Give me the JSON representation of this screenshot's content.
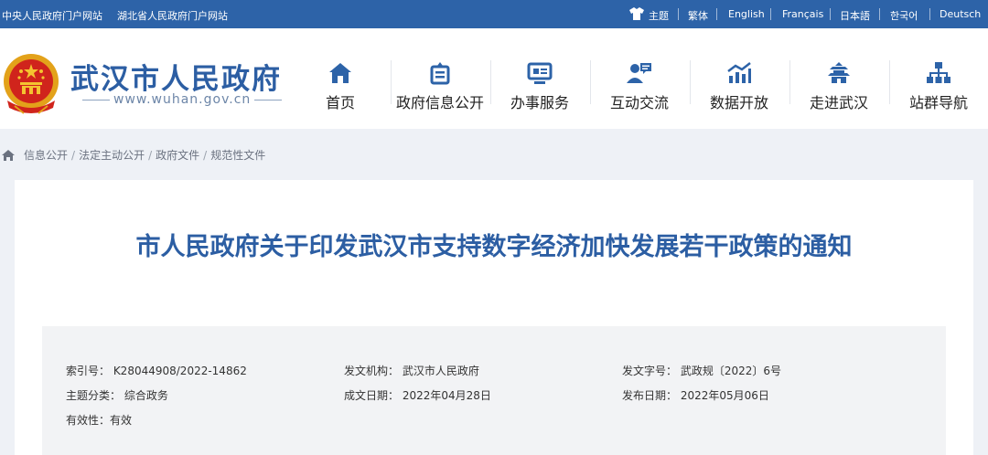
{
  "topbar": {
    "link_central": "中央人民政府门户网站",
    "link_province": "湖北省人民政府门户网站",
    "theme": "主题",
    "languages": [
      "繁体",
      "English",
      "Français",
      "日本語",
      "한국어",
      "Deutsch"
    ]
  },
  "header": {
    "site_title": "武汉市人民政府",
    "site_url": "www.wuhan.gov.cn"
  },
  "nav": [
    {
      "label": "首页",
      "icon": "home-icon"
    },
    {
      "label": "政府信息公开",
      "icon": "info-disclosure-icon"
    },
    {
      "label": "办事服务",
      "icon": "service-icon"
    },
    {
      "label": "互动交流",
      "icon": "interaction-icon"
    },
    {
      "label": "数据开放",
      "icon": "chart-icon"
    },
    {
      "label": "走进武汉",
      "icon": "tower-icon"
    },
    {
      "label": "站群导航",
      "icon": "sitemap-icon"
    }
  ],
  "breadcrumb": [
    "信息公开",
    "法定主动公开",
    "政府文件",
    "规范性文件"
  ],
  "article": {
    "title": "市人民政府关于印发武汉市支持数字经济加快发展若干政策的通知",
    "meta": {
      "index_no": "索引号： K28044908/2022-14862",
      "issuer": "发文机构： 武汉市人民政府",
      "doc_no": "发文字号： 武政规〔2022〕6号",
      "category": "主题分类： 综合政务",
      "created_date": "成文日期： 2022年04月28日",
      "published_date": "发布日期： 2022年05月06日",
      "validity": "有效性：有效"
    }
  },
  "colors": {
    "brand_blue": "#2d63a8",
    "title_blue": "#2c5ea3"
  }
}
